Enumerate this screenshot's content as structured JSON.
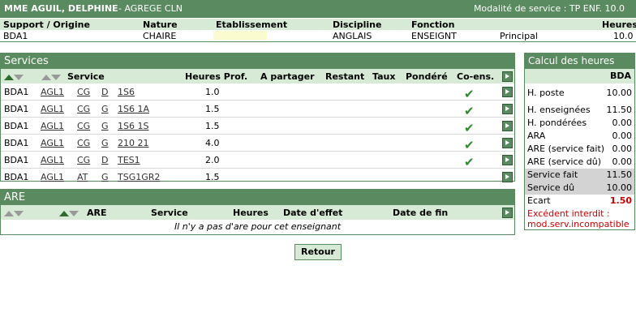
{
  "header": {
    "name": "MME AGUIL, DELPHINE",
    "grade": "- AGREGE CLN",
    "modalite": "Modalité  de service : TP ENF.  10.0"
  },
  "support_table": {
    "headers": [
      "Support / Origine",
      "Nature",
      "Etablissement",
      "Discipline",
      "Fonction",
      "Heures"
    ],
    "values": [
      "BDA1",
      "CHAIRE",
      "",
      "ANGLAIS",
      "ENSEIGNT",
      "Principal",
      "10.0"
    ]
  },
  "services": {
    "title": "Services",
    "col_service": "Service",
    "col_heures": "Heures Prof.",
    "col_partager": "A partager",
    "col_restant": "Restant",
    "col_taux": "Taux",
    "col_pondere": "Pondéré",
    "col_coens": "Co-ens.",
    "rows": [
      {
        "support": "BDA1",
        "c1": "AGL1",
        "c2": "CG",
        "c3": "D",
        "c4": "1S6",
        "heures": "1.0",
        "coens": true
      },
      {
        "support": "BDA1",
        "c1": "AGL1",
        "c2": "CG",
        "c3": "G",
        "c4": "1S6  1A",
        "heures": "1.5",
        "coens": true
      },
      {
        "support": "BDA1",
        "c1": "AGL1",
        "c2": "CG",
        "c3": "G",
        "c4": "1S6  1S",
        "heures": "1.5",
        "coens": true
      },
      {
        "support": "BDA1",
        "c1": "AGL1",
        "c2": "CG",
        "c3": "G",
        "c4": "210  21",
        "heures": "4.0",
        "coens": true
      },
      {
        "support": "BDA1",
        "c1": "AGL1",
        "c2": "CG",
        "c3": "D",
        "c4": "TES1",
        "heures": "2.0",
        "coens": true
      },
      {
        "support": "BDA1",
        "c1": "AGL1",
        "c2": "AT",
        "c3": "G",
        "c4": "TSG1GR2",
        "heures": "1.5",
        "coens": false
      }
    ]
  },
  "are": {
    "title": "ARE",
    "col_are": "ARE",
    "col_service": "Service",
    "col_heures": "Heures",
    "col_date_effet": "Date d'effet",
    "col_date_fin": "Date de fin",
    "empty_message": "Il n'y a pas d'are pour cet enseignant"
  },
  "calcul": {
    "title": "Calcul des heures",
    "col": "BDA",
    "rows": [
      {
        "label": "H. poste",
        "value": "10.00"
      },
      {
        "label": "H. enseignées",
        "value": "11.50"
      },
      {
        "label": "H. pondérées",
        "value": "0.00"
      },
      {
        "label": "ARA",
        "value": "0.00"
      },
      {
        "label": "ARE (service fait)",
        "value": "0.00"
      },
      {
        "label": "ARE (service dû)",
        "value": "0.00"
      }
    ],
    "service_fait_label": "Service fait",
    "service_fait_value": "11.50",
    "service_du_label": "Service dû",
    "service_du_value": "10.00",
    "ecart_label": "Ecart",
    "ecart_value": "1.50",
    "warning_line1": "Excédent interdit :",
    "warning_line2": "mod.serv.incompatible"
  },
  "buttons": {
    "retour": "Retour"
  },
  "colors": {
    "accent": "#5a8a5f",
    "light": "#d7ead5",
    "check": "#2e8b2e",
    "warning": "#cc0000"
  }
}
